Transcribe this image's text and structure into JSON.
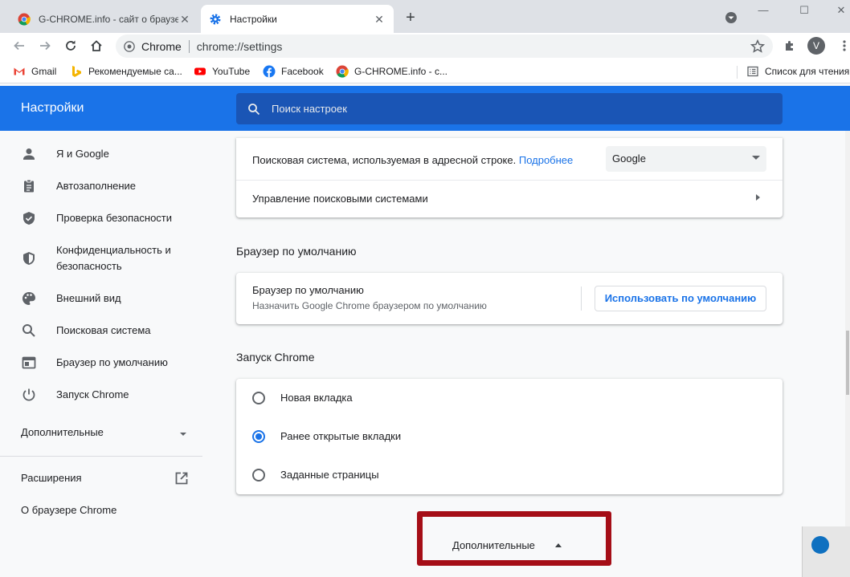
{
  "tabs": [
    {
      "title": "G-CHROME.info - сайт о браузере",
      "active": false
    },
    {
      "title": "Настройки",
      "active": true
    }
  ],
  "toolbar": {
    "site_chip": "Chrome",
    "url": "chrome://settings",
    "avatar_letter": "V"
  },
  "bookmarks": [
    {
      "label": "Gmail",
      "icon": "gmail-icon"
    },
    {
      "label": "Рекомендуемые са...",
      "icon": "bing-icon"
    },
    {
      "label": "YouTube",
      "icon": "youtube-icon"
    },
    {
      "label": "Facebook",
      "icon": "facebook-icon"
    },
    {
      "label": "G-CHROME.info - с...",
      "icon": "chrome-icon"
    }
  ],
  "reading_list": "Список для чтения",
  "header": {
    "title": "Настройки",
    "search_placeholder": "Поиск настроек"
  },
  "sidebar": {
    "items": [
      {
        "label": "Я и Google",
        "icon": "person-icon"
      },
      {
        "label": "Автозаполнение",
        "icon": "clipboard-icon"
      },
      {
        "label": "Проверка безопасности",
        "icon": "shield-check-icon"
      },
      {
        "label": "Конфиденциальность и безопасность",
        "icon": "shield-half-icon"
      },
      {
        "label": "Внешний вид",
        "icon": "palette-icon"
      },
      {
        "label": "Поисковая система",
        "icon": "search-icon"
      },
      {
        "label": "Браузер по умолчанию",
        "icon": "browser-window-icon"
      },
      {
        "label": "Запуск Chrome",
        "icon": "power-icon"
      }
    ],
    "advanced": "Дополнительные",
    "extensions": "Расширения",
    "about": "О браузере Chrome"
  },
  "search_engine": {
    "row1_text": "Поисковая система, используемая в адресной строке.",
    "row1_link": "Подробнее",
    "selected": "Google",
    "row2_text": "Управление поисковыми системами"
  },
  "default_browser": {
    "section_title": "Браузер по умолчанию",
    "title": "Браузер по умолчанию",
    "subtitle": "Назначить Google Chrome браузером по умолчанию",
    "button": "Использовать по умолчанию"
  },
  "startup": {
    "section_title": "Запуск Chrome",
    "options": [
      {
        "label": "Новая вкладка",
        "checked": false
      },
      {
        "label": "Ранее открытые вкладки",
        "checked": true
      },
      {
        "label": "Заданные страницы",
        "checked": false
      }
    ]
  },
  "advanced_footer": "Дополнительные",
  "colors": {
    "accent": "#1a73e8",
    "highlight_box": "#a50e17"
  }
}
